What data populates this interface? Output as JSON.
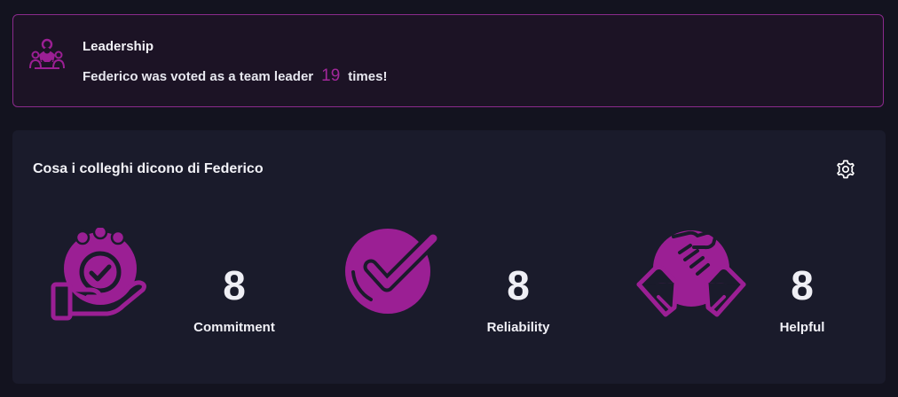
{
  "leadership": {
    "title": "Leadership",
    "text_before": "Federico was voted as a team leader",
    "count": "19",
    "text_after": "times!",
    "icon": "team-leader-icon"
  },
  "feedback": {
    "title": "Cosa i colleghi dicono di Federico",
    "settings_icon": "gear-icon",
    "stats": [
      {
        "label": "Commitment",
        "value": "8",
        "icon": "commitment-hand-clock-icon"
      },
      {
        "label": "Reliability",
        "value": "8",
        "icon": "check-circle-icon"
      },
      {
        "label": "Helpful",
        "value": "8",
        "icon": "handshake-icon"
      }
    ]
  },
  "colors": {
    "accent": "#9b1f94",
    "page_background": "#13131f",
    "card_background": "#1a1b2b",
    "leader_card_border": "#8a2a8c"
  }
}
